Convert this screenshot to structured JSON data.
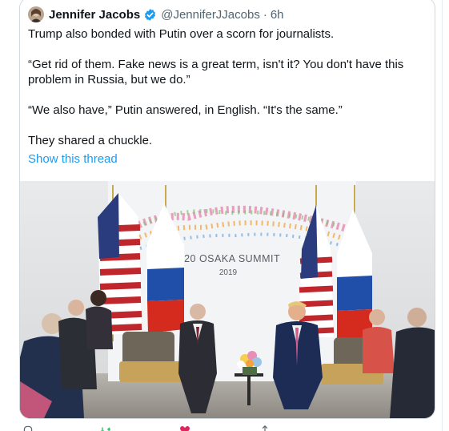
{
  "tweet": {
    "author_name": "Jennifer Jacobs",
    "handle": "@JenniferJJacobs",
    "separator": "·",
    "time": "6h",
    "paragraphs": [
      "Trump also bonded with Putin over a scorn for journalists.",
      "“Get rid of them. Fake news is a great term, isn't it? You don't have this problem in Russia, but we do.”",
      "“We also have,” Putin answered, in English. “It's the same.”",
      "They shared a chuckle."
    ],
    "show_thread": "Show this thread"
  },
  "photo": {
    "backdrop_line1": "G20 OSAKA SUMMIT",
    "backdrop_line2": "2019"
  },
  "colors": {
    "link": "#1d9bf0",
    "verified": "#1d9bf0",
    "muted": "#536471",
    "border": "#cfd9de"
  },
  "icons": [
    "verified-badge-icon",
    "reply-icon",
    "retweet-icon",
    "like-icon",
    "share-icon"
  ]
}
